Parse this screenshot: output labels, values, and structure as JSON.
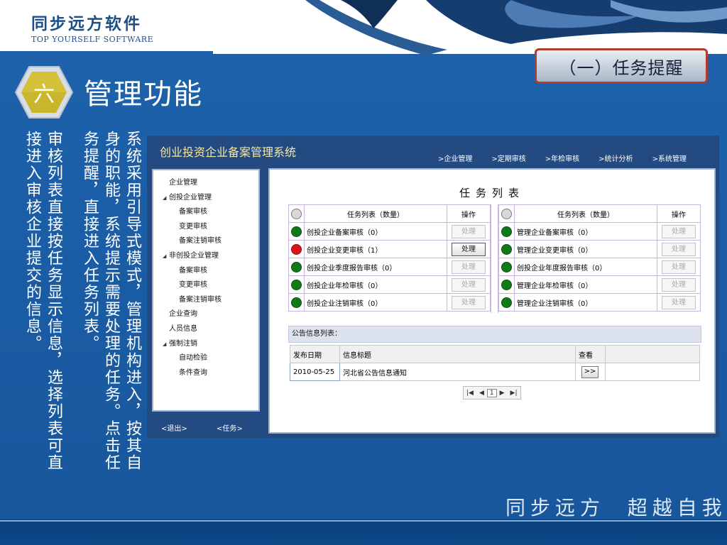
{
  "header": {
    "company_cn": "同步远方软件",
    "company_en": "TOP YOURSELF SOFTWARE",
    "section_badge": "（一）任务提醒"
  },
  "section": {
    "number": "六",
    "title": "管理功能"
  },
  "description_columns": [
    "系统采用引导式模式，管理机构进入，按其自",
    "身的职能，系统提示需要处理的任务。点击任",
    "务提醒，直接进入任务列表。",
    "审核列表直接按任务显示信息，选择列表可直",
    "接进入审核企业提交的信息。"
  ],
  "footer": {
    "slogan": "同步远方  超越自我"
  },
  "app": {
    "title": "创业投资企业备案管理系统",
    "top_nav": [
      ">企业管理",
      ">定期审核",
      ">年检审核",
      ">统计分析",
      ">系统管理"
    ],
    "sidebar": {
      "items": [
        {
          "label": "企业管理",
          "level": 0,
          "expandable": false
        },
        {
          "label": "创投企业管理",
          "level": 0,
          "expandable": true
        },
        {
          "label": "备案审核",
          "level": 1
        },
        {
          "label": "变更审核",
          "level": 1
        },
        {
          "label": "备案注销审核",
          "level": 1
        },
        {
          "label": "非创投企业管理",
          "level": 0,
          "expandable": true
        },
        {
          "label": "备案审核",
          "level": 1
        },
        {
          "label": "变更审核",
          "level": 1
        },
        {
          "label": "备案注销审核",
          "level": 1
        },
        {
          "label": "企业查询",
          "level": 0,
          "expandable": false
        },
        {
          "label": "人员信息",
          "level": 0,
          "expandable": false
        },
        {
          "label": "强制注销",
          "level": 0,
          "expandable": true
        },
        {
          "label": "自动检验",
          "level": 1
        },
        {
          "label": "条件查询",
          "level": 1
        }
      ],
      "logout_label": "<退出>",
      "task_label": "<任务>"
    },
    "task_panel": {
      "title": "任务列表",
      "header_name": "任务列表（数量）",
      "header_op": "操作",
      "left": [
        {
          "name": "创投企业备案审核（0）",
          "status": "green",
          "op": "处理",
          "enabled": false
        },
        {
          "name": "创投企业变更审核（1）",
          "status": "red",
          "op": "处理",
          "enabled": true
        },
        {
          "name": "创投企业季度报告审核（0）",
          "status": "green",
          "op": "处理",
          "enabled": false
        },
        {
          "name": "创投企业年检审核（0）",
          "status": "green",
          "op": "处理",
          "enabled": false
        },
        {
          "name": "创投企业注销审核（0）",
          "status": "green",
          "op": "处理",
          "enabled": false
        }
      ],
      "right": [
        {
          "name": "管理企业备案审核（0）",
          "status": "green",
          "op": "处理",
          "enabled": false
        },
        {
          "name": "管理企业变更审核（0）",
          "status": "green",
          "op": "处理",
          "enabled": false
        },
        {
          "name": "创投企业年度报告审核（0）",
          "status": "green",
          "op": "处理",
          "enabled": false
        },
        {
          "name": "管理企业年检审核（0）",
          "status": "green",
          "op": "处理",
          "enabled": false
        },
        {
          "name": "管理企业注销审核（0）",
          "status": "green",
          "op": "处理",
          "enabled": false
        }
      ]
    },
    "notice": {
      "header": "公告信息列表：",
      "columns": [
        "发布日期",
        "信息标题",
        "查看"
      ],
      "rows": [
        {
          "date": "2010-05-25",
          "title": "河北省公告信息通知",
          "view": ">>"
        }
      ],
      "pager_current": "1"
    }
  },
  "colors": {
    "slide_blue": "#1a5ca4",
    "badge_border": "#b03c2c",
    "app_title": "#f4e9a0",
    "status_green": "#117a19",
    "status_red": "#d9151b"
  }
}
